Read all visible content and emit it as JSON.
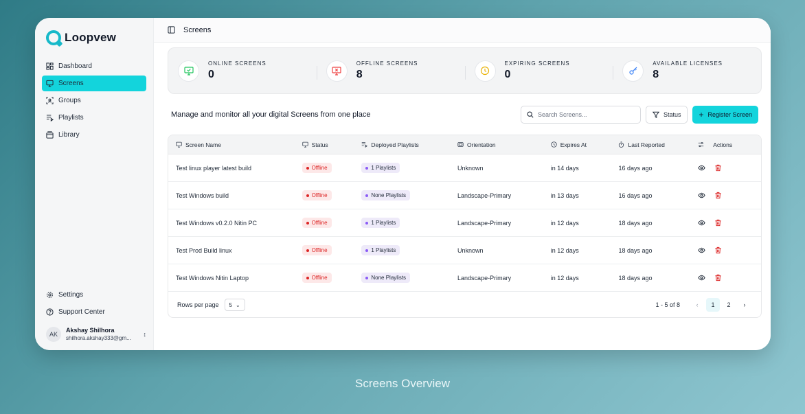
{
  "app": {
    "name": "Loopvew"
  },
  "sidebar": {
    "items": [
      {
        "label": "Dashboard",
        "icon": "dashboard-icon"
      },
      {
        "label": "Screens",
        "icon": "monitor-icon",
        "active": true
      },
      {
        "label": "Groups",
        "icon": "groups-icon"
      },
      {
        "label": "Playlists",
        "icon": "playlist-icon"
      },
      {
        "label": "Library",
        "icon": "library-icon"
      }
    ],
    "bottom": [
      {
        "label": "Settings",
        "icon": "gear-icon"
      },
      {
        "label": "Support Center",
        "icon": "help-icon"
      }
    ],
    "user": {
      "initials": "AK",
      "name": "Akshay Shilhora",
      "email": "shilhora.akshay333@gm..."
    }
  },
  "topbar": {
    "title": "Screens"
  },
  "stats": [
    {
      "label": "ONLINE SCREENS",
      "value": "0",
      "icon": "monitor-check-icon",
      "color": "#22c55e"
    },
    {
      "label": "OFFLINE SCREENS",
      "value": "8",
      "icon": "monitor-x-icon",
      "color": "#ef4444"
    },
    {
      "label": "EXPIRING SCREENS",
      "value": "0",
      "icon": "clock-icon",
      "color": "#eab308"
    },
    {
      "label": "AVAILABLE LICENSES",
      "value": "8",
      "icon": "key-icon",
      "color": "#3b82f6"
    }
  ],
  "toolbar": {
    "description": "Manage and monitor all your digital Screens from one place",
    "search_placeholder": "Search Screens...",
    "status_label": "Status",
    "register_label": "Register Screen"
  },
  "table": {
    "columns": [
      "Screen Name",
      "Status",
      "Deployed Playlists",
      "Orientation",
      "Expires At",
      "Last Reported",
      "Actions"
    ],
    "rows": [
      {
        "name": "Test linux player latest build",
        "status": "Offline",
        "playlists": "1 Playlists",
        "orientation": "Unknown",
        "expires": "in 14 days",
        "reported": "16 days ago"
      },
      {
        "name": "Test Windows build",
        "status": "Offline",
        "playlists": "None Playlists",
        "orientation": "Landscape-Primary",
        "expires": "in 13 days",
        "reported": "16 days ago"
      },
      {
        "name": "Test Windows v0.2.0 Nitin PC",
        "status": "Offline",
        "playlists": "1 Playlists",
        "orientation": "Landscape-Primary",
        "expires": "in 12 days",
        "reported": "18 days ago"
      },
      {
        "name": "Test Prod Build linux",
        "status": "Offline",
        "playlists": "1 Playlists",
        "orientation": "Unknown",
        "expires": "in 12 days",
        "reported": "18 days ago"
      },
      {
        "name": "Test Windows Nitin Laptop",
        "status": "Offline",
        "playlists": "None Playlists",
        "orientation": "Landscape-Primary",
        "expires": "in 12 days",
        "reported": "18 days ago"
      }
    ]
  },
  "pagination": {
    "rows_per_page_label": "Rows per page",
    "rows_per_page": "5",
    "range": "1 - 5 of 8",
    "pages": [
      "1",
      "2"
    ],
    "current": "1"
  },
  "caption": "Screens Overview",
  "colors": {
    "accent": "#13d4dc",
    "danger": "#dc2626",
    "playlist_dot": "#8b5cf6"
  }
}
